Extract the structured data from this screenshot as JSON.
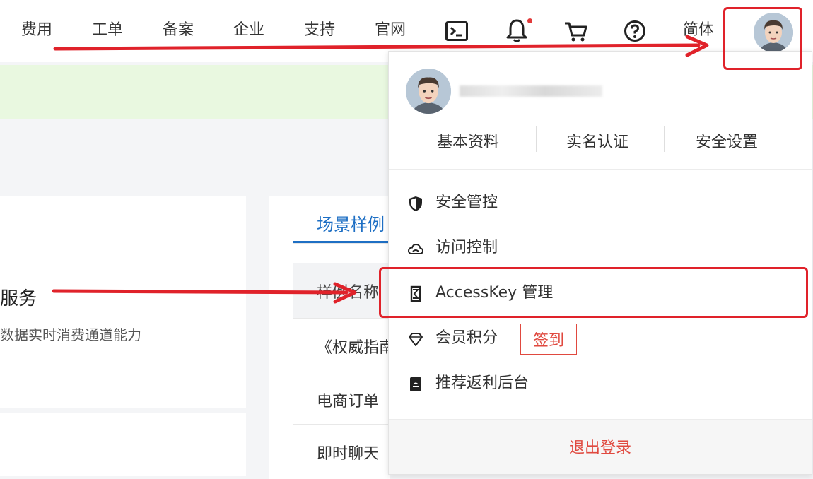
{
  "topnav": {
    "items": [
      "费用",
      "工单",
      "备案",
      "企业",
      "支持",
      "官网"
    ],
    "lang": "简体",
    "icons": [
      "terminal-icon",
      "bell-icon",
      "cart-icon",
      "help-icon"
    ]
  },
  "left_card": {
    "title": "服务",
    "desc": "数据实时消费通道能力"
  },
  "middle": {
    "tab": "场景样例",
    "header": "样例名称",
    "rows": [
      "《权威指南》",
      "电商订单",
      "即时聊天"
    ]
  },
  "dropdown": {
    "profile_links": [
      "基本资料",
      "实名认证",
      "安全设置"
    ],
    "menu": [
      {
        "label": "安全管控",
        "icon": "shield-icon"
      },
      {
        "label": "访问控制",
        "icon": "cloud-icon"
      },
      {
        "label": "AccessKey 管理",
        "icon": "key-icon"
      },
      {
        "label": "会员积分",
        "icon": "diamond-icon"
      },
      {
        "label": "推荐返利后台",
        "icon": "document-icon"
      }
    ],
    "signin": "签到",
    "logout": "退出登录"
  },
  "colors": {
    "accent": "#1e6fc4",
    "highlight": "#e0222a",
    "danger": "#e0493f",
    "banner": "#e9f8e0"
  }
}
